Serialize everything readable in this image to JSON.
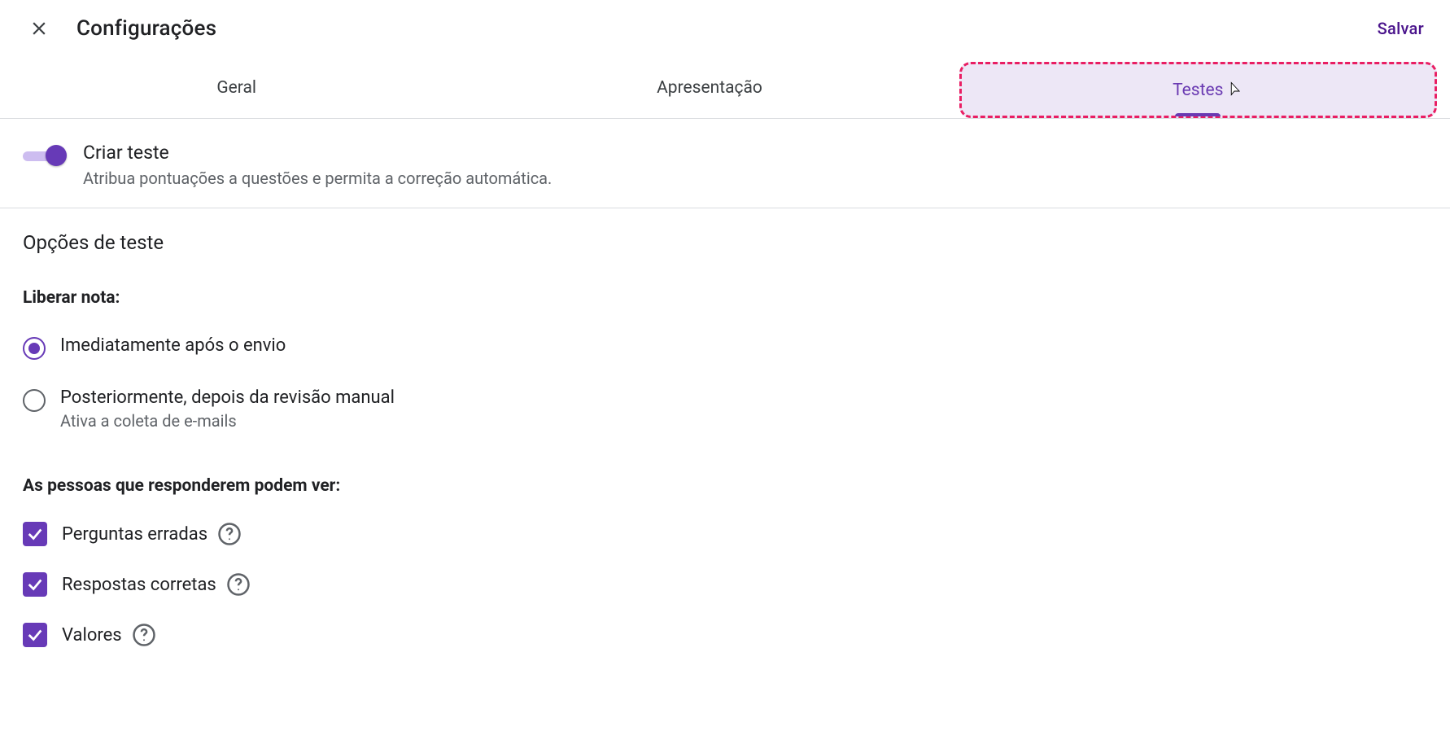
{
  "header": {
    "title": "Configurações",
    "save_label": "Salvar"
  },
  "tabs": [
    {
      "label": "Geral",
      "active": false,
      "highlight": false
    },
    {
      "label": "Apresentação",
      "active": false,
      "highlight": false
    },
    {
      "label": "Testes",
      "active": true,
      "highlight": true
    }
  ],
  "quiz_toggle": {
    "title": "Criar teste",
    "subtitle": "Atribua pontuações a questões e permita a correção automática.",
    "on": true
  },
  "options": {
    "heading": "Opções de teste",
    "release_grade": {
      "label": "Liberar nota:",
      "choices": [
        {
          "label": "Imediatamente após o envio",
          "subtitle": "",
          "selected": true
        },
        {
          "label": "Posteriormente, depois da revisão manual",
          "subtitle": "Ativa a coleta de e-mails",
          "selected": false
        }
      ]
    },
    "respondent_can_see": {
      "label": "As pessoas que responderem podem ver:",
      "items": [
        {
          "label": "Perguntas erradas",
          "checked": true,
          "help": true
        },
        {
          "label": "Respostas corretas",
          "checked": true,
          "help": true
        },
        {
          "label": "Valores",
          "checked": true,
          "help": true
        }
      ]
    }
  }
}
